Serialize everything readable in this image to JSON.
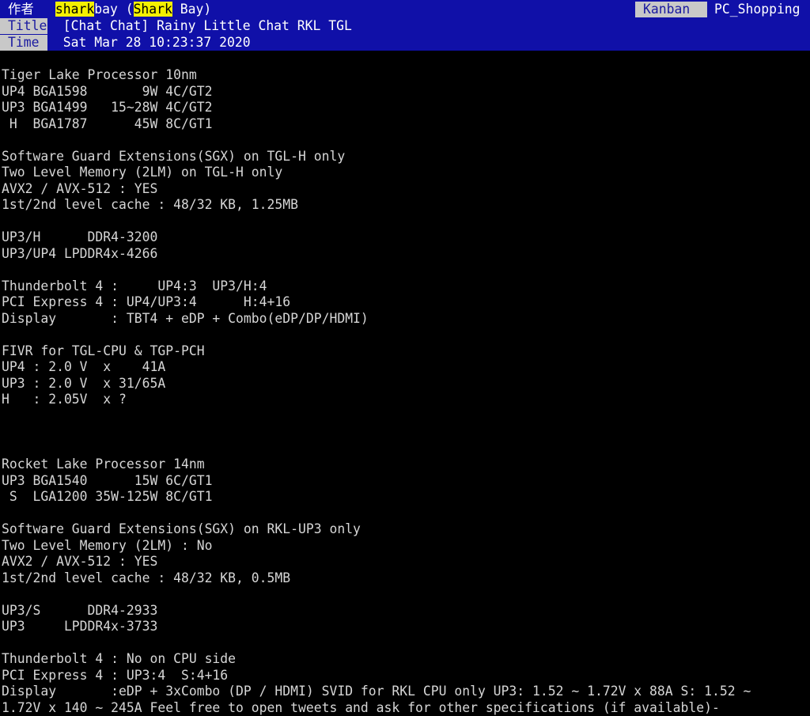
{
  "header": {
    "author_label": "作者",
    "author_pre": " ",
    "author_hi1": "shark",
    "author_mid1": "bay (",
    "author_hi2": "Shark",
    "author_post": " Bay)",
    "title_label": "Title",
    "title_value": "[Chat Chat] Rainy Little Chat RKL TGL",
    "time_label": "Time",
    "time_value": "Sat Mar 28 10:23:37 2020",
    "kanban_label": "Kanban",
    "board_name": "PC_Shopping"
  },
  "article": {
    "lines": [
      "Tiger Lake Processor 10nm",
      "UP4 BGA1598       9W 4C/GT2",
      "UP3 BGA1499   15~28W 4C/GT2",
      " H  BGA1787      45W 8C/GT1",
      "",
      "Software Guard Extensions(SGX) on TGL-H only",
      "Two Level Memory (2LM) on TGL-H only",
      "AVX2 / AVX-512 : YES",
      "1st/2nd level cache : 48/32 KB, 1.25MB",
      "",
      "UP3/H      DDR4-3200",
      "UP3/UP4 LPDDR4x-4266",
      "",
      "Thunderbolt 4 :     UP4:3  UP3/H:4",
      "PCI Express 4 : UP4/UP3:4      H:4+16",
      "Display       : TBT4 + eDP + Combo(eDP/DP/HDMI)",
      "",
      "FIVR for TGL-CPU & TGP-PCH",
      "UP4 : 2.0 V  x    41A",
      "UP3 : 2.0 V  x 31/65A",
      "H   : 2.05V  x ?",
      "",
      "",
      "",
      "Rocket Lake Processor 14nm",
      "UP3 BGA1540      15W 6C/GT1",
      " S  LGA1200 35W-125W 8C/GT1",
      "",
      "Software Guard Extensions(SGX) on RKL-UP3 only",
      "Two Level Memory (2LM) : No",
      "AVX2 / AVX-512 : YES",
      "1st/2nd level cache : 48/32 KB, 0.5MB",
      "",
      "UP3/S      DDR4-2933",
      "UP3     LPDDR4x-3733",
      "",
      "Thunderbolt 4 : No on CPU side",
      "PCI Express 4 : UP3:4  S:4+16",
      "Display       :eDP + 3xCombo (DP / HDMI) SVID for RKL CPU only UP3: 1.52 ~ 1.72V x 88A S: 1.52 ~",
      "1.72V x 140 ~ 245A Feel free to open tweets and ask for other specifications (if available)-"
    ]
  }
}
